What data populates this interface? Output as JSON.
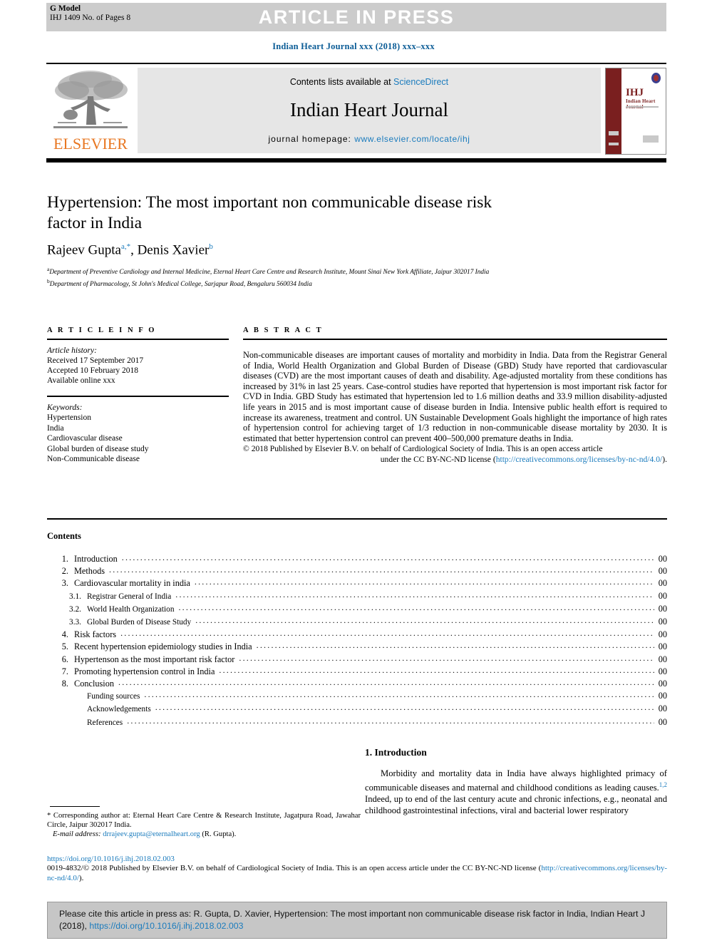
{
  "header": {
    "g_model_line1": "G Model",
    "g_model_line2": "IHJ 1409 No. of Pages 8",
    "press_banner": "ARTICLE IN PRESS",
    "journal_citation": "Indian Heart Journal xxx (2018) xxx–xxx"
  },
  "masthead": {
    "contents_prefix": "Contents lists available at ",
    "contents_link": "ScienceDirect",
    "journal_title": "Indian Heart Journal",
    "homepage_prefix": "journal homepage: ",
    "homepage_link": "www.elsevier.com/locate/ihj",
    "publisher_wordmark": "ELSEVIER",
    "cover_title": "IHJ",
    "cover_subtitle": "Indian Heart Journal"
  },
  "article": {
    "title": "Hypertension: The most important non communicable disease risk factor in India",
    "authors_plain": "Rajeev Gupta",
    "author1": "Rajeev Gupta",
    "author1_sup": "a,*",
    "author2": "Denis Xavier",
    "author2_sup": "b",
    "affiliation_a_sup": "a",
    "affiliation_a": "Department of Preventive Cardiology and Internal Medicine, Eternal Heart Care Centre and Research Institute, Mount Sinai New York Affiliate, Jaipur 302017 India",
    "affiliation_b_sup": "b",
    "affiliation_b": "Department of Pharmacology, St John's Medical College, Sarjapur Road, Bengaluru 560034 India"
  },
  "article_info": {
    "heading": "A R T I C L E   I N F O",
    "history_label": "Article history:",
    "received": "Received 17 September 2017",
    "accepted": "Accepted 10 February 2018",
    "available": "Available online xxx",
    "keywords_label": "Keywords:",
    "keywords": [
      "Hypertension",
      "India",
      "Cardiovascular disease",
      "Global burden of disease study",
      "Non-Communicable disease"
    ]
  },
  "abstract": {
    "heading": "A B S T R A C T",
    "body": "Non-communicable diseases are important causes of mortality and morbidity in India. Data from the Registrar General of India, World Health Organization and Global Burden of Disease (GBD) Study have reported that cardiovascular diseases (CVD) are the most important causes of death and disability. Age-adjusted mortality from these conditions has increased by 31% in last 25 years. Case-control studies have reported that hypertension is most important risk factor for CVD in India. GBD Study has estimated that hypertension led to 1.6 million deaths and 33.9 million disability-adjusted life years in 2015 and is most important cause of disease burden in India. Intensive public health effort is required to increase its awareness, treatment and control. UN Sustainable Development Goals highlight the importance of high rates of hypertension control for achieving target of 1/3 reduction in non-communicable disease mortality by 2030. It is estimated that better hypertension control can prevent 400–500,000 premature deaths in India.",
    "copyright_line1": "© 2018 Published by Elsevier B.V. on behalf of Cardiological Society of India. This is an open access article",
    "copyright_line2_prefix": "under the CC BY-NC-ND license (",
    "copyright_link": "http://creativecommons.org/licenses/by-nc-nd/4.0/",
    "copyright_line2_suffix": ")."
  },
  "contents": {
    "heading": "Contents",
    "items": [
      {
        "num": "1.",
        "label": "Introduction",
        "page": "00",
        "level": 1
      },
      {
        "num": "2.",
        "label": "Methods",
        "page": "00",
        "level": 1
      },
      {
        "num": "3.",
        "label": "Cardiovascular mortality in india",
        "page": "00",
        "level": 1
      },
      {
        "num": "3.1.",
        "label": "Registrar General of India",
        "page": "00",
        "level": 2
      },
      {
        "num": "3.2.",
        "label": "World Health Organization",
        "page": "00",
        "level": 2
      },
      {
        "num": "3.3.",
        "label": "Global Burden of Disease Study",
        "page": "00",
        "level": 2
      },
      {
        "num": "4.",
        "label": "Risk factors",
        "page": "00",
        "level": 1
      },
      {
        "num": "5.",
        "label": "Recent hypertension epidemiology studies in India",
        "page": "00",
        "level": 1
      },
      {
        "num": "6.",
        "label": "Hypertenson as the most important risk factor",
        "page": "00",
        "level": 1
      },
      {
        "num": "7.",
        "label": "Promoting hypertension control in India",
        "page": "00",
        "level": 1
      },
      {
        "num": "8.",
        "label": "Conclusion",
        "page": "00",
        "level": 1
      },
      {
        "num": "",
        "label": "Funding sources",
        "page": "00",
        "level": 2
      },
      {
        "num": "",
        "label": "Acknowledgements",
        "page": "00",
        "level": 2
      },
      {
        "num": "",
        "label": "References",
        "page": "00",
        "level": 2
      }
    ]
  },
  "introduction": {
    "heading": "1. Introduction",
    "paragraph_part1": "Morbidity and mortality data in India have always highlighted primacy of communicable diseases and maternal and childhood conditions as leading causes.",
    "citation_sup": "1,2",
    "paragraph_part2": " Indeed, up to end of the last century acute and chronic infections, e.g., neonatal and childhood gastrointestinal infections, viral and bacterial lower respiratory"
  },
  "footnote": {
    "star": "*",
    "corresponding": " Corresponding author at: Eternal Heart Care Centre & Research Institute, Jagatpura Road, Jawahar Circle, Jaipur 302017 India.",
    "email_label": "E-mail address:",
    "email": "drrajeev.gupta@eternalheart.org",
    "email_owner": " (R. Gupta)."
  },
  "bottom": {
    "doi": "https://doi.org/10.1016/j.ihj.2018.02.003",
    "issn_copyright": "0019-4832/© 2018 Published by Elsevier B.V. on behalf of Cardiological Society of India. This is an open access article under the CC BY-NC-ND license (",
    "licence_link": "http://creativecommons.org/licenses/by-nc-nd/4.0/",
    "licence_suffix": ")."
  },
  "cite_box": {
    "text_prefix": "Please cite this article in press as: R. Gupta, D. Xavier, Hypertension: The most important non communicable disease risk factor in India, Indian Heart J (2018), ",
    "link": "https://doi.org/10.1016/j.ihj.2018.02.003"
  },
  "colors": {
    "link": "#1a7bbd",
    "journal_blue": "#0b5c96",
    "elsevier_orange": "#e87722",
    "banner_grey": "#cccccc",
    "masthead_grey": "#e6e6e6",
    "cite_grey": "#c6c6c6",
    "cover_maroon": "#7a1f1f"
  }
}
